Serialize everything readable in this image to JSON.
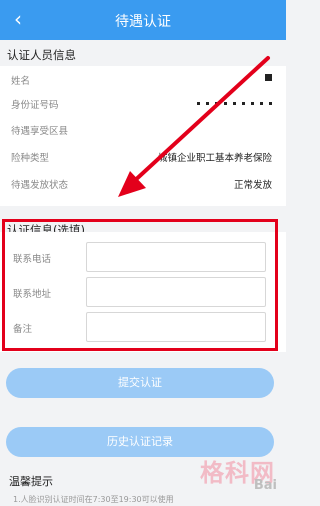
{
  "header": {
    "title": "待遇认证",
    "back_icon": "chevron-left-icon"
  },
  "info_section": {
    "title": "认证人员信息",
    "rows": [
      {
        "label": "姓名",
        "value": ""
      },
      {
        "label": "身份证号码",
        "value": ""
      },
      {
        "label": "待遇享受区县",
        "value": ""
      },
      {
        "label": "险种类型",
        "value": "城镇企业职工基本养老保险"
      },
      {
        "label": "待遇发放状态",
        "value": "正常发放"
      }
    ]
  },
  "form_section": {
    "title": "认证信息(选填)",
    "fields": [
      {
        "label": "联系电话",
        "value": ""
      },
      {
        "label": "联系地址",
        "value": ""
      },
      {
        "label": "备注",
        "value": ""
      }
    ]
  },
  "actions": {
    "submit_label": "提交认证",
    "history_label": "历史认证记录"
  },
  "tips": {
    "title": "温馨提示",
    "line1": "1.人脸识别认证时间在7:30至19:30可以使用"
  },
  "watermark": {
    "cn": "格科网",
    "en": "Bai"
  },
  "colors": {
    "header": "#3a9bf0",
    "button": "#9bcaf6",
    "highlight": "#e3001b"
  }
}
